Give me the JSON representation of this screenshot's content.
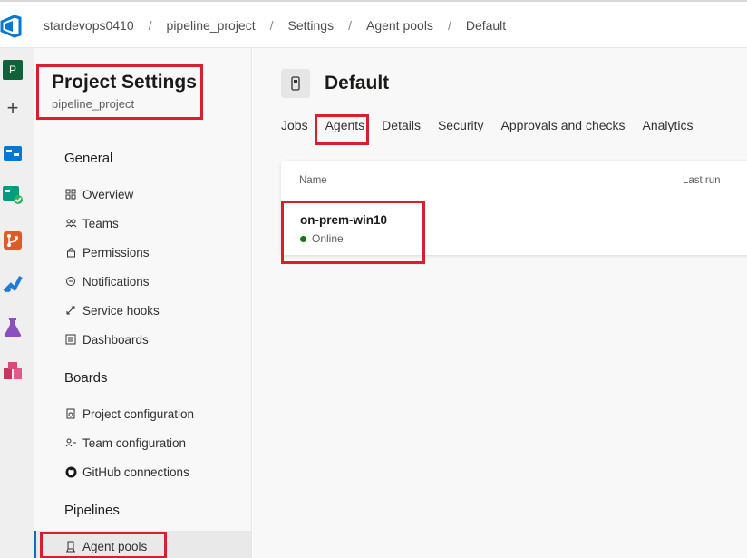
{
  "breadcrumb": {
    "items": [
      "stardevops0410",
      "pipeline_project",
      "Settings",
      "Agent pools",
      "Default"
    ],
    "separator": "/"
  },
  "rail": {
    "project_initial": "P",
    "add_label": "+"
  },
  "sidebar": {
    "title": "Project Settings",
    "subtitle": "pipeline_project",
    "groups": [
      {
        "label": "General",
        "items": [
          "Overview",
          "Teams",
          "Permissions",
          "Notifications",
          "Service hooks",
          "Dashboards"
        ]
      },
      {
        "label": "Boards",
        "items": [
          "Project configuration",
          "Team configuration",
          "GitHub connections"
        ]
      },
      {
        "label": "Pipelines",
        "items": [
          "Agent pools"
        ]
      }
    ]
  },
  "main": {
    "title": "Default",
    "tabs": [
      "Jobs",
      "Agents",
      "Details",
      "Security",
      "Approvals and checks",
      "Analytics"
    ],
    "selected_tab": "Agents",
    "columns": {
      "name": "Name",
      "last_run": "Last run"
    },
    "agent": {
      "name": "on-prem-win10",
      "status": "Online"
    }
  },
  "colors": {
    "accent": "#0f6cbd",
    "highlight": "#d9202a",
    "online": "#107c10",
    "project_avatar": "#11623b"
  }
}
